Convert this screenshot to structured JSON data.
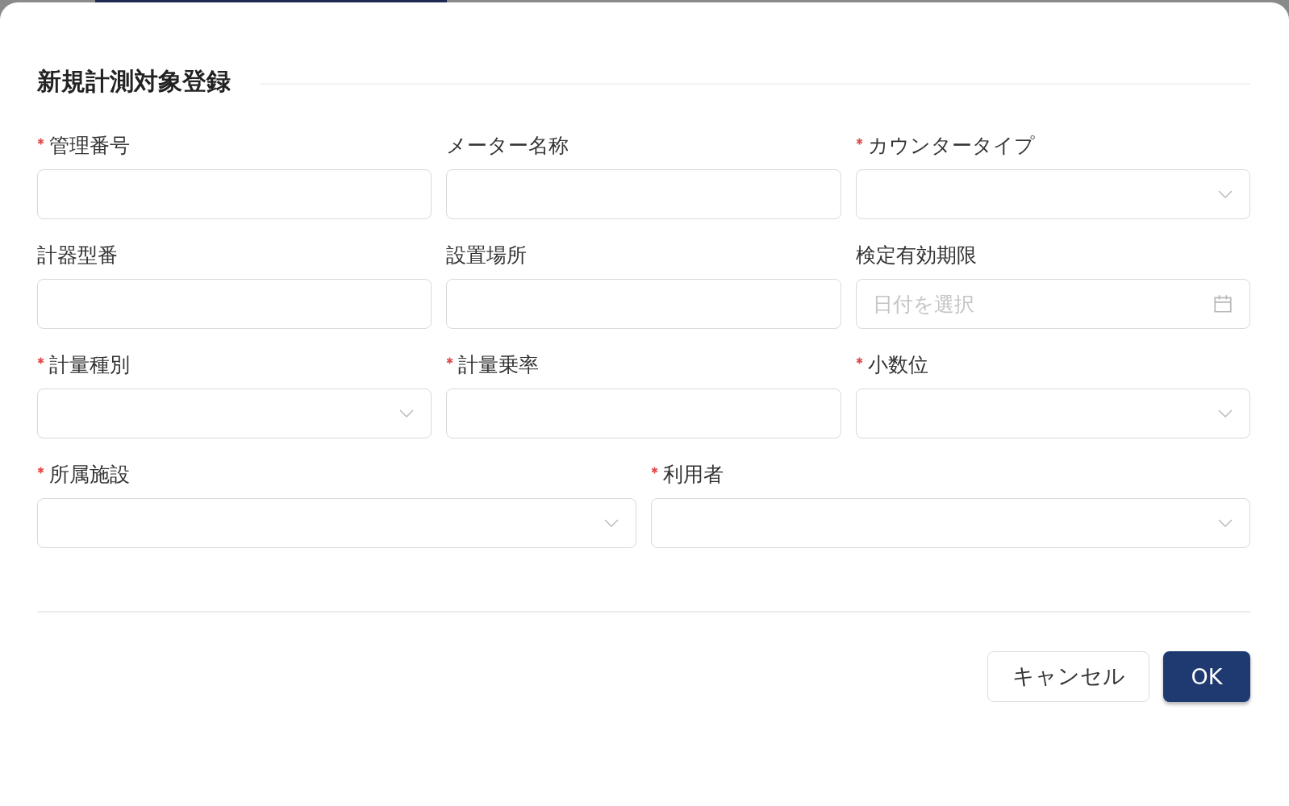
{
  "dialog": {
    "title": "新規計測対象登録",
    "rows": [
      [
        {
          "label": "管理番号",
          "required": true,
          "kind": "text"
        },
        {
          "label": "メーター名称",
          "required": false,
          "kind": "text"
        },
        {
          "label": "カウンタータイプ",
          "required": true,
          "kind": "select"
        }
      ],
      [
        {
          "label": "計器型番",
          "required": false,
          "kind": "text"
        },
        {
          "label": "設置場所",
          "required": false,
          "kind": "text"
        },
        {
          "label": "検定有効期限",
          "required": false,
          "kind": "date",
          "placeholder": "日付を選択"
        }
      ],
      [
        {
          "label": "計量種別",
          "required": true,
          "kind": "select"
        },
        {
          "label": "計量乗率",
          "required": true,
          "kind": "text"
        },
        {
          "label": "小数位",
          "required": true,
          "kind": "select"
        }
      ],
      [
        {
          "label": "所属施設",
          "required": true,
          "kind": "select"
        },
        {
          "label": "利用者",
          "required": true,
          "kind": "select"
        }
      ]
    ],
    "buttons": [
      {
        "label": "キャンセル",
        "kind": "secondary"
      },
      {
        "label": "OK",
        "kind": "primary"
      }
    ]
  }
}
